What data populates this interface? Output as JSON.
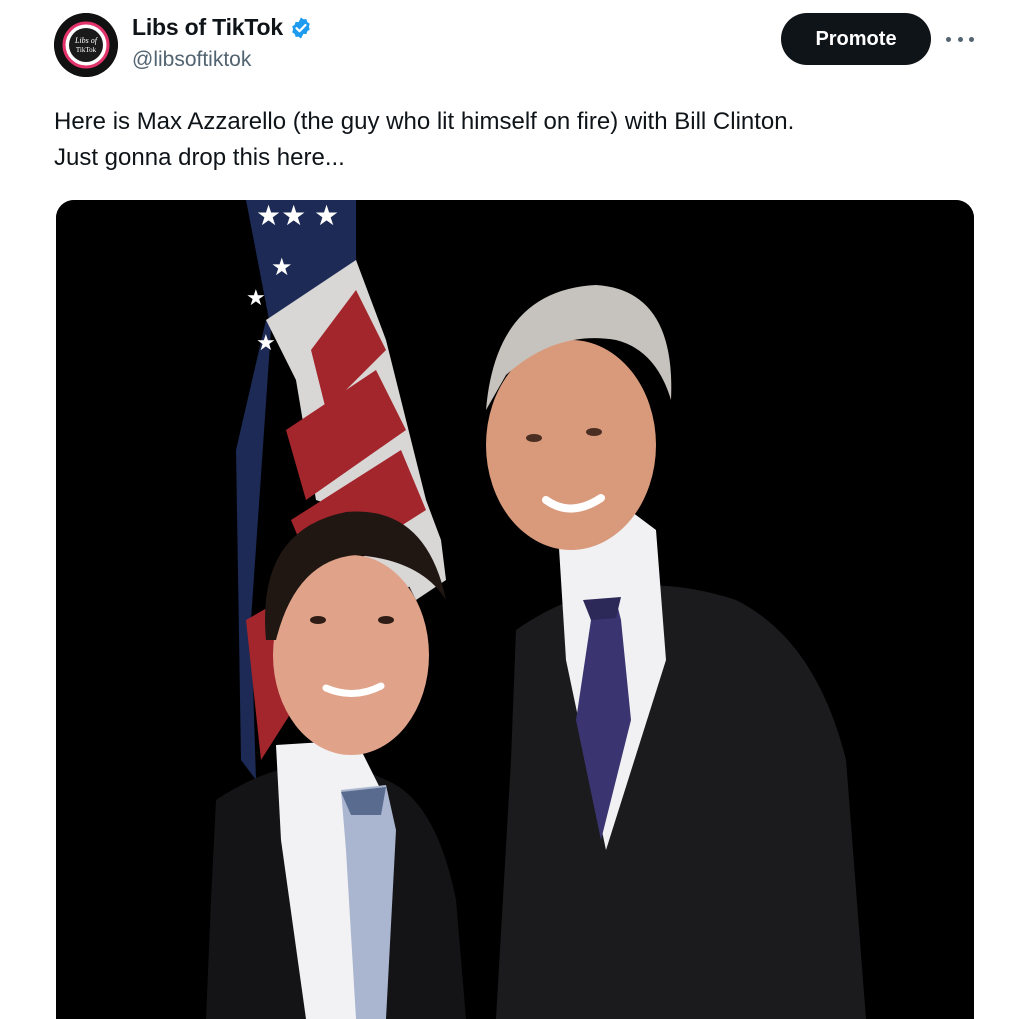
{
  "author": {
    "display_name": "Libs of TikTok",
    "handle": "@libsoftiktok",
    "verified": true,
    "avatar_text": [
      "Libs of",
      "TikTok"
    ]
  },
  "actions": {
    "promote_label": "Promote",
    "more_icon": "more-horizontal-icon"
  },
  "tweet": {
    "text_lines": [
      "Here is Max Azzarello (the guy who lit himself on fire) with Bill Clinton.",
      "Just gonna drop this here..."
    ]
  },
  "media": {
    "description_icon": "photo",
    "colors": {
      "background": "#000000",
      "flag_red": "#a3262c",
      "flag_blue": "#1c2a55",
      "accent_verified": "#1d9bf0"
    }
  }
}
